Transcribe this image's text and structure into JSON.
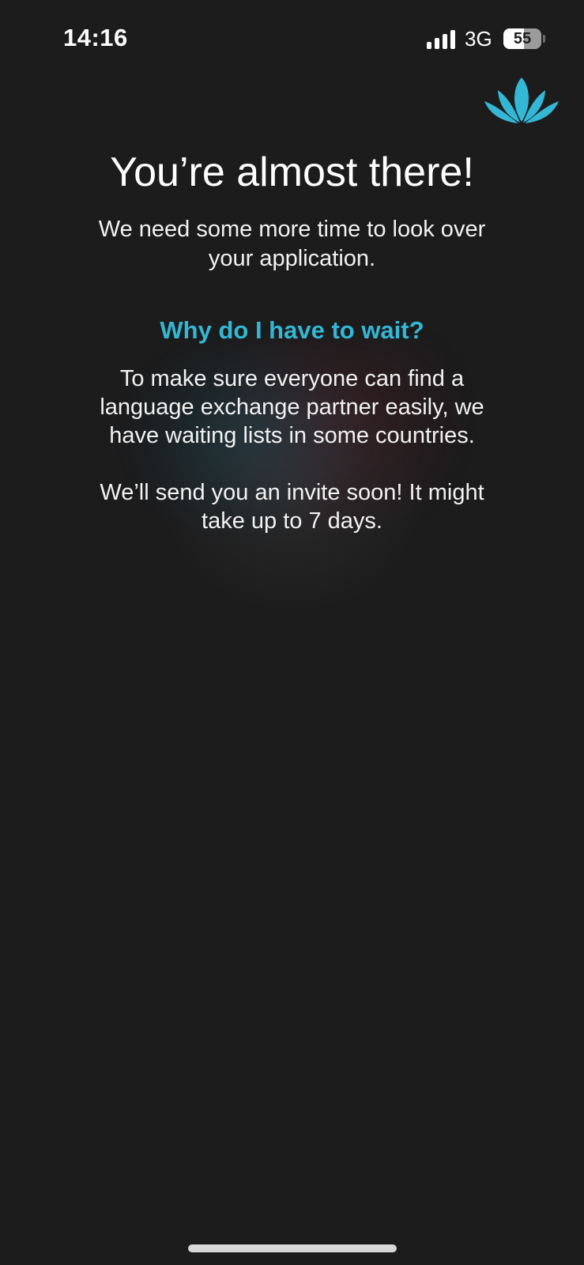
{
  "status_bar": {
    "time": "14:16",
    "network": "3G",
    "battery_level": "55",
    "battery_fraction": 0.55
  },
  "logo": {
    "icon": "lotus-icon",
    "color": "#34b7d4"
  },
  "content": {
    "title": "You’re almost there!",
    "subtitle": "We need some more time to look over your application.",
    "question": "Why do I have to wait?",
    "explanation": "To make sure everyone can find a language exchange partner easily, we have waiting lists in some countries.",
    "invite_message": "We’ll send you an invite soon! It might take up to 7 days."
  },
  "theme": {
    "background": "#1c1c1d",
    "accent": "#34b7d4",
    "text": "#ffffff"
  }
}
